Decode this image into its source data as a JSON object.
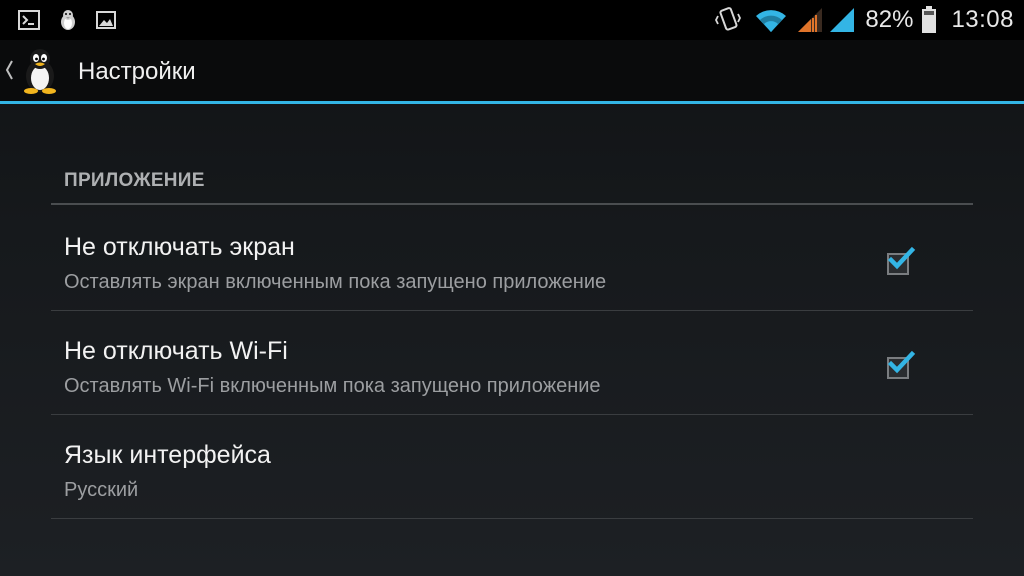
{
  "status_bar": {
    "battery_percent": "82%",
    "clock": "13:08",
    "left_icons": [
      "terminal-icon",
      "penguin-icon",
      "image-icon"
    ],
    "right_icons": [
      "vibrate-phone-icon",
      "wifi-icon",
      "signal-orange-icon",
      "signal-blue-icon",
      "battery-icon"
    ],
    "colors": {
      "wifi": "#33b5e5",
      "signal_sim1": "#e0742a",
      "signal_sim2": "#33b5e5"
    }
  },
  "action_bar": {
    "title": "Настройки",
    "up_icon": "chevron-left-icon",
    "logo_icon": "penguin-logo-icon",
    "accent_color": "#33b5e5"
  },
  "preferences": {
    "category": "ПРИЛОЖЕНИЕ",
    "items": [
      {
        "title": "Не отключать экран",
        "summary": "Оставлять экран включенным пока запущено приложение",
        "checked": true
      },
      {
        "title": "Не отключать Wi-Fi",
        "summary": "Оставлять Wi-Fi включенным пока запущено приложение",
        "checked": true
      },
      {
        "title": "Язык интерфейса",
        "summary": "Русский"
      }
    ]
  }
}
